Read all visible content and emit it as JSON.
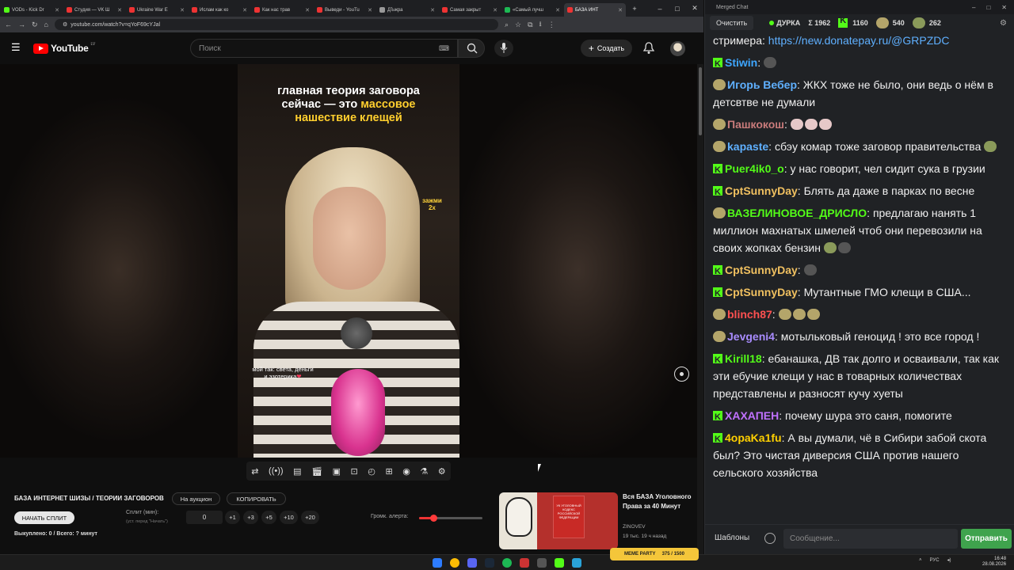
{
  "tabs": [
    {
      "label": "VODs - Kick Dr",
      "color": "#53fc18"
    },
    {
      "label": "Студия — VK Ш",
      "color": "#e33"
    },
    {
      "label": "Ukraine War E",
      "color": "#e33"
    },
    {
      "label": "Ислам как ко",
      "color": "#e33"
    },
    {
      "label": "Как нас трав",
      "color": "#e33"
    },
    {
      "label": "Выведи - YouTu",
      "color": "#e33"
    },
    {
      "label": "ДЪжра",
      "color": "#999"
    },
    {
      "label": "Самая закрыт",
      "color": "#e33"
    },
    {
      "label": "«Самый лучш",
      "color": "#1db954"
    },
    {
      "label": "БАЗА ИНТ",
      "color": "#e33"
    }
  ],
  "address": {
    "url": "youtube.com/watch?v=qYoF69cYJal"
  },
  "youtube": {
    "logo_text": "YouTube",
    "region": "LV",
    "search_placeholder": "Поиск",
    "create_label": "Создать"
  },
  "video": {
    "title_line1": "главная теория заговора",
    "title_line2": "сейчас — это ",
    "title_highlight1": "массовое",
    "title_highlight2": "нашествие клещей",
    "hold_label": "зажми",
    "hold_speed": "2x",
    "caption_line1": "мой так: света, деньги",
    "caption_line2": "и эзотерика",
    "caption_heart": "❤"
  },
  "panel": {
    "stream_title": "БАЗА ИНТЕРНЕТ ШИЗЫ / ТЕОРИИ ЗАГОВОРОВ",
    "auction_label": "На аукцион",
    "copy_label": "КОПИРОВАТЬ",
    "start_split_label": "НАЧАТЬ СПЛИТ",
    "split_label": "Сплит (мин):",
    "split_hint": "(уст. перед \"Начать\")",
    "split_value": "0",
    "increments": [
      "+1",
      "+3",
      "+5",
      "+10",
      "+20"
    ],
    "alert_volume_label": "Громк. алерта:",
    "alert_volume": 0.22,
    "bought_label": "Выкуплено: 0 / Всего: ? минут"
  },
  "recommended": {
    "title": "Вся БАЗА Уголовного Права за 40 Минут",
    "channel": "ZINOVEV",
    "meta": "19 тыс.   19 ч назад",
    "book_text": "УК УГОЛОВНЫЙ КОДЕКС РОССИЙСКОЙ ФЕДЕРАЦИИ"
  },
  "chat": {
    "window_title": "Merged Chat",
    "clear_label": "Очистить",
    "channel_name": "ДУРКА",
    "stat_sigma": "Σ 1962",
    "stat_kick": "1160",
    "stat_a": "540",
    "stat_b": "262",
    "intro_text": "стримера: ",
    "intro_link": "https://new.donatepay.ru/@GRPZDC",
    "messages": [
      {
        "name": "Stiwin",
        "color": "#3ea6ff",
        "text": "",
        "badge": "kick",
        "emotes": "d"
      },
      {
        "name": "Игорь Вебер",
        "color": "#5fb0ff",
        "text": "ЖКХ тоже не было, они ведь о нём в детсвтве не думали",
        "badge": "emo"
      },
      {
        "name": "Пашкокош",
        "color": "#c97b7b",
        "text": "",
        "badge": "emo",
        "emotes": "ppp"
      },
      {
        "name": "kapaste",
        "color": "#5fb0ff",
        "text": "сбэу комар тоже заговор правительства",
        "badge": "emo",
        "emotes": "g"
      },
      {
        "name": "Puer4ik0_o",
        "color": "#53fc18",
        "text": "у нас говорит, чел сидит сука в грузии",
        "badge": "kick"
      },
      {
        "name": "CptSunnyDay",
        "color": "#f0c060",
        "text": "Блять да даже в парках по весне",
        "badge": "kick"
      },
      {
        "name": "ВАЗЕЛИНОВОЕ_ДРИСЛО",
        "color": "#53fc18",
        "text": "предлагаю нанять 1 миллион махнатых шмелей чтоб они перевозили на своих жопках бензин",
        "badge": "emo",
        "emotes": "gd"
      },
      {
        "name": "CptSunnyDay",
        "color": "#f0c060",
        "text": "",
        "badge": "kick",
        "emotes": "d"
      },
      {
        "name": "CptSunnyDay",
        "color": "#f0c060",
        "text": "Мутантные ГМО клещи в США...",
        "badge": "kick"
      },
      {
        "name": "blinch87",
        "color": "#ff5050",
        "text": "",
        "badge": "emo",
        "emotes": "eee"
      },
      {
        "name": "Jevgeni4",
        "color": "#a98cff",
        "text": "мотыльковый геноцид ! это все город !",
        "badge": "emo"
      },
      {
        "name": "Kirill18",
        "color": "#53fc18",
        "text": "ебанашка, ДВ так долго и осваивали, так как эти ебучие клещи у нас в товарных количествах представлены и разносят кучу хуеты",
        "badge": "kick"
      },
      {
        "name": "ХАХАПЕН",
        "color": "#c071ff",
        "text": "почему шура это саня, помогите",
        "badge": "kick"
      },
      {
        "name": "4opaKa1fu",
        "color": "#ffd000",
        "text": "А вы думали, чё в Сибири забой скота был? Это чистая диверсия США против нашего сельского хозяйства",
        "badge": "kick"
      }
    ],
    "templates_label": "Шаблоны",
    "input_placeholder": "Сообщение...",
    "send_label": "Отправить"
  },
  "taskbar": {
    "badge_label": "MEME PARTY",
    "badge_count": "375 / 1500",
    "lang": "РУС",
    "time": "16:48",
    "date": "28.08.2026"
  }
}
